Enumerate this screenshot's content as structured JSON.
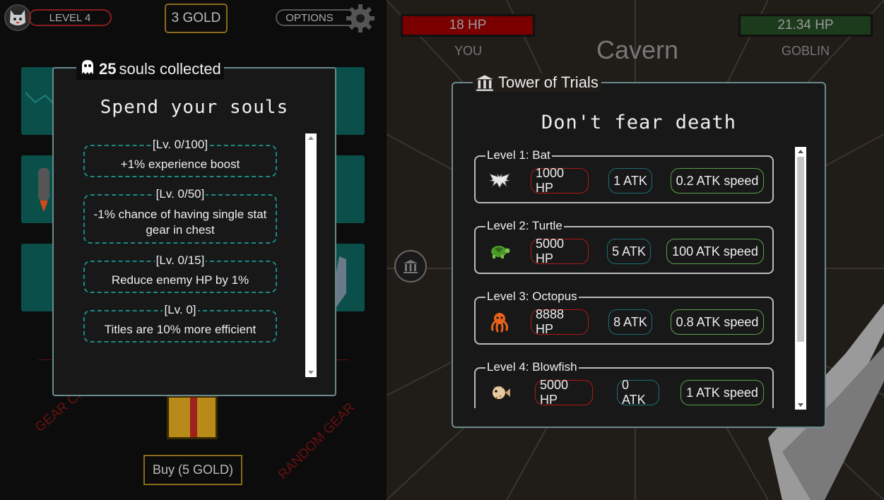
{
  "left": {
    "level": "LEVEL 4",
    "gold": "3 GOLD",
    "options": "OPTIONS",
    "gear_chest_label": "GEAR CHEST",
    "random_gear_label": "RANDOM GEAR",
    "buy_label": "Buy (5 GOLD)"
  },
  "souls": {
    "count": "25",
    "collected_text": "souls collected",
    "title": "Spend your souls",
    "upgrades": [
      {
        "level": "[Lv. 0/100]",
        "desc": "+1% experience boost"
      },
      {
        "level": "[Lv. 0/50]",
        "desc": "-1% chance of having single stat gear in chest"
      },
      {
        "level": "[Lv. 0/15]",
        "desc": "Reduce enemy HP by 1%"
      },
      {
        "level": "[Lv. 0]",
        "desc": "Titles are 10% more efficient"
      }
    ]
  },
  "battle": {
    "player_hp": "18 HP",
    "player_label": "YOU",
    "location": "Cavern",
    "enemy_hp": "21.34 HP",
    "enemy_label": "GOBLIN",
    "colors": {
      "player_hp": "#7a0000",
      "enemy_hp": "#1c3a1c"
    }
  },
  "tower": {
    "title": "Tower of Trials",
    "subtitle": "Don't fear death",
    "levels": [
      {
        "name": "Level 1: Bat",
        "icon": "bat-icon",
        "hp": "1000 HP",
        "atk": "1 ATK",
        "speed": "0.2 ATK speed"
      },
      {
        "name": "Level 2: Turtle",
        "icon": "turtle-icon",
        "hp": "5000 HP",
        "atk": "5 ATK",
        "speed": "100 ATK speed"
      },
      {
        "name": "Level 3: Octopus",
        "icon": "octopus-icon",
        "hp": "8888 HP",
        "atk": "8 ATK",
        "speed": "0.8 ATK speed"
      },
      {
        "name": "Level 4: Blowfish",
        "icon": "blowfish-icon",
        "hp": "5000 HP",
        "atk": "0 ATK",
        "speed": "1 ATK speed"
      }
    ]
  }
}
